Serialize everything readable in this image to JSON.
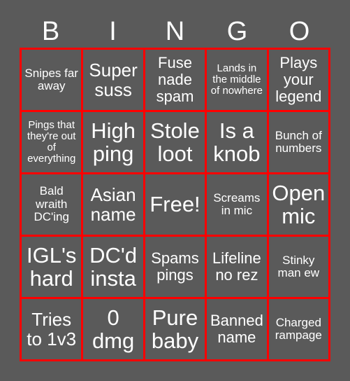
{
  "colors": {
    "background": "#5a5a5a",
    "cell_background": "#5a5a5a",
    "border": "#ff0000",
    "text": "#ffffff"
  },
  "header": {
    "letters": [
      "B",
      "I",
      "N",
      "G",
      "O"
    ]
  },
  "grid": {
    "rows": 5,
    "columns": 5,
    "cells": [
      {
        "text": "Snipes far away",
        "size": "sm"
      },
      {
        "text": "Super suss",
        "size": "lg"
      },
      {
        "text": "Fuse nade spam",
        "size": "md"
      },
      {
        "text": "Lands in the middle of nowhere",
        "size": "xs"
      },
      {
        "text": "Plays your legend",
        "size": "md"
      },
      {
        "text": "Pings that they're out of everything",
        "size": "xs"
      },
      {
        "text": "High ping",
        "size": "xl"
      },
      {
        "text": "Stole loot",
        "size": "xl"
      },
      {
        "text": "Is a knob",
        "size": "xl"
      },
      {
        "text": "Bunch of numbers",
        "size": "sm"
      },
      {
        "text": "Bald wraith DC'ing",
        "size": "sm"
      },
      {
        "text": "Asian name",
        "size": "lg"
      },
      {
        "text": "Free!",
        "size": "xl"
      },
      {
        "text": "Screams in mic",
        "size": "sm"
      },
      {
        "text": "Open mic",
        "size": "xl"
      },
      {
        "text": "IGL's hard",
        "size": "xl"
      },
      {
        "text": "DC'd insta",
        "size": "xl"
      },
      {
        "text": "Spams pings",
        "size": "md"
      },
      {
        "text": "Lifeline no rez",
        "size": "md"
      },
      {
        "text": "Stinky man ew",
        "size": "sm"
      },
      {
        "text": "Tries to 1v3",
        "size": "lg"
      },
      {
        "text": "0 dmg",
        "size": "xl"
      },
      {
        "text": "Pure baby",
        "size": "xl"
      },
      {
        "text": "Banned name",
        "size": "md"
      },
      {
        "text": "Charged rampage",
        "size": "sm"
      }
    ]
  }
}
